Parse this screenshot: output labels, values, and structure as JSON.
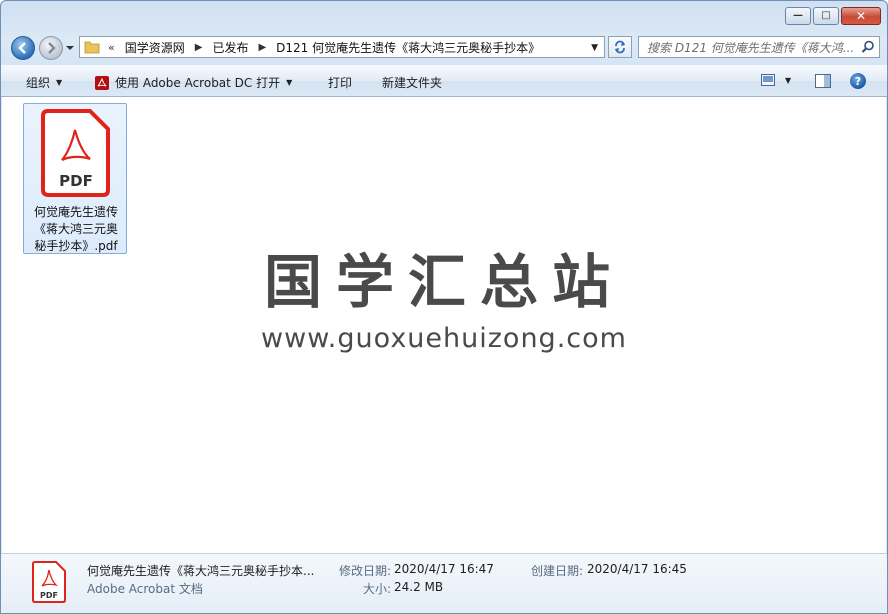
{
  "window": {
    "caption_buttons": [
      "minimize",
      "maximize",
      "close"
    ]
  },
  "address_bar": {
    "overflow": "«",
    "crumbs": [
      "国学资源网",
      "已发布",
      "D121 何觉庵先生遗传《蒋大鸿三元奥秘手抄本》"
    ]
  },
  "search": {
    "placeholder": "搜索 D121 何觉庵先生遗传《蒋大鸿..."
  },
  "toolbar": {
    "organize": "组织",
    "open_with": "使用 Adobe Acrobat DC 打开",
    "print": "打印",
    "new_folder": "新建文件夹"
  },
  "file": {
    "icon_label": "PDF",
    "name_lines": [
      "何觉庵先生遗传",
      "《蒋大鸿三元奥",
      "秘手抄本》.pdf"
    ]
  },
  "watermark": {
    "title": "国学汇总站",
    "url": "www.guoxuehuizong.com"
  },
  "details": {
    "name": "何觉庵先生遗传《蒋大鸿三元奥秘手抄本...",
    "type": "Adobe Acrobat 文档",
    "modified_label": "修改日期:",
    "modified_value": "2020/4/17 16:47",
    "size_label": "大小:",
    "size_value": "24.2 MB",
    "created_label": "创建日期:",
    "created_value": "2020/4/17 16:45",
    "icon_label": "PDF"
  },
  "colors": {
    "pdf_red": "#e2231a",
    "selection": "#dcebfc",
    "watermark": "#4a4a4a"
  }
}
